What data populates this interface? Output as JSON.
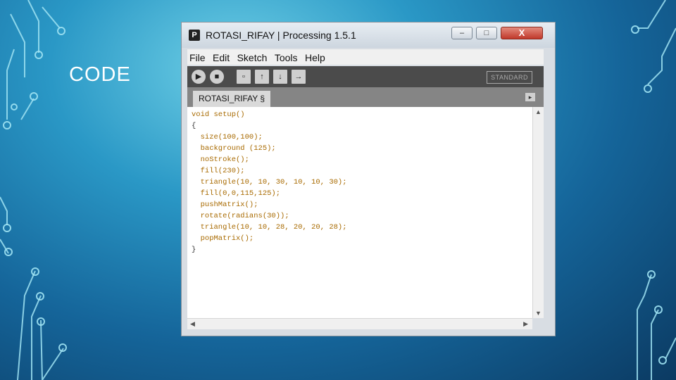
{
  "slide": {
    "title": "CODE"
  },
  "window": {
    "title": "ROTASI_RIFAY | Processing 1.5.1",
    "icon_letter": "P",
    "controls": {
      "minimize": "–",
      "maximize": "□",
      "close": "X"
    }
  },
  "menu": [
    "File",
    "Edit",
    "Sketch",
    "Tools",
    "Help"
  ],
  "toolbar": {
    "icons": [
      "run-icon",
      "stop-icon",
      "new-icon",
      "open-icon",
      "save-icon",
      "export-icon"
    ],
    "mode": "STANDARD"
  },
  "tab": {
    "name": "ROTASI_RIFAY §",
    "arrow": "▸"
  },
  "code": {
    "lines": [
      "void setup()",
      "{",
      "  size(100,100);",
      "  background (125);",
      "  noStroke();",
      "  fill(230);",
      "  triangle(10, 10, 30, 10, 10, 30);",
      "  fill(0,0,115,125);",
      "  pushMatrix();",
      "  rotate(radians(30));",
      "  triangle(10, 10, 28, 20, 20, 28);",
      "  popMatrix();",
      "}"
    ]
  },
  "colors": {
    "background": "#2a98c6",
    "toolbar": "#4b4b4b",
    "tabbar": "#858585",
    "keyword": "#a86a00"
  }
}
